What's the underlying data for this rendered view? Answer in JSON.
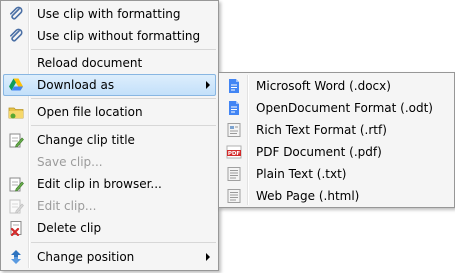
{
  "main_menu": {
    "items": [
      {
        "label": "Use clip with formatting",
        "icon": "paperclip-icon"
      },
      {
        "label": "Use clip without formatting",
        "icon": "paperclip-icon"
      },
      {
        "label": "Reload document",
        "icon": ""
      },
      {
        "label": "Download as",
        "icon": "google-drive-icon",
        "highlighted": true
      },
      {
        "label": "Open file location",
        "icon": "folder-icon"
      },
      {
        "label": "Change clip title",
        "icon": "notepad-edit-icon"
      },
      {
        "label": "Save clip...",
        "icon": "",
        "disabled": true
      },
      {
        "label": "Edit clip in browser...",
        "icon": "notepad-edit-icon"
      },
      {
        "label": "Edit clip...",
        "icon": "notepad-icon",
        "disabled": true
      },
      {
        "label": "Delete clip",
        "icon": "delete-document-icon"
      },
      {
        "label": "Change position",
        "icon": "up-down-arrows-icon"
      }
    ]
  },
  "submenu": {
    "items": [
      {
        "label": "Microsoft Word (.docx)",
        "icon": "docs-icon"
      },
      {
        "label": "OpenDocument Format (.odt)",
        "icon": "docs-icon"
      },
      {
        "label": "Rich Text Format (.rtf)",
        "icon": "rich-text-icon"
      },
      {
        "label": "PDF Document (.pdf)",
        "icon": "pdf-icon",
        "icon_text": "PDF"
      },
      {
        "label": "Plain Text (.txt)",
        "icon": "text-file-icon"
      },
      {
        "label": "Web Page (.html)",
        "icon": "text-file-icon"
      }
    ]
  },
  "colors": {
    "menu_bg": "#f5f5f5",
    "highlight_border": "#88b6e2",
    "docs_blue": "#4285f4",
    "pdf_red": "#d22a2a",
    "disabled_text": "#9b9b9b"
  }
}
